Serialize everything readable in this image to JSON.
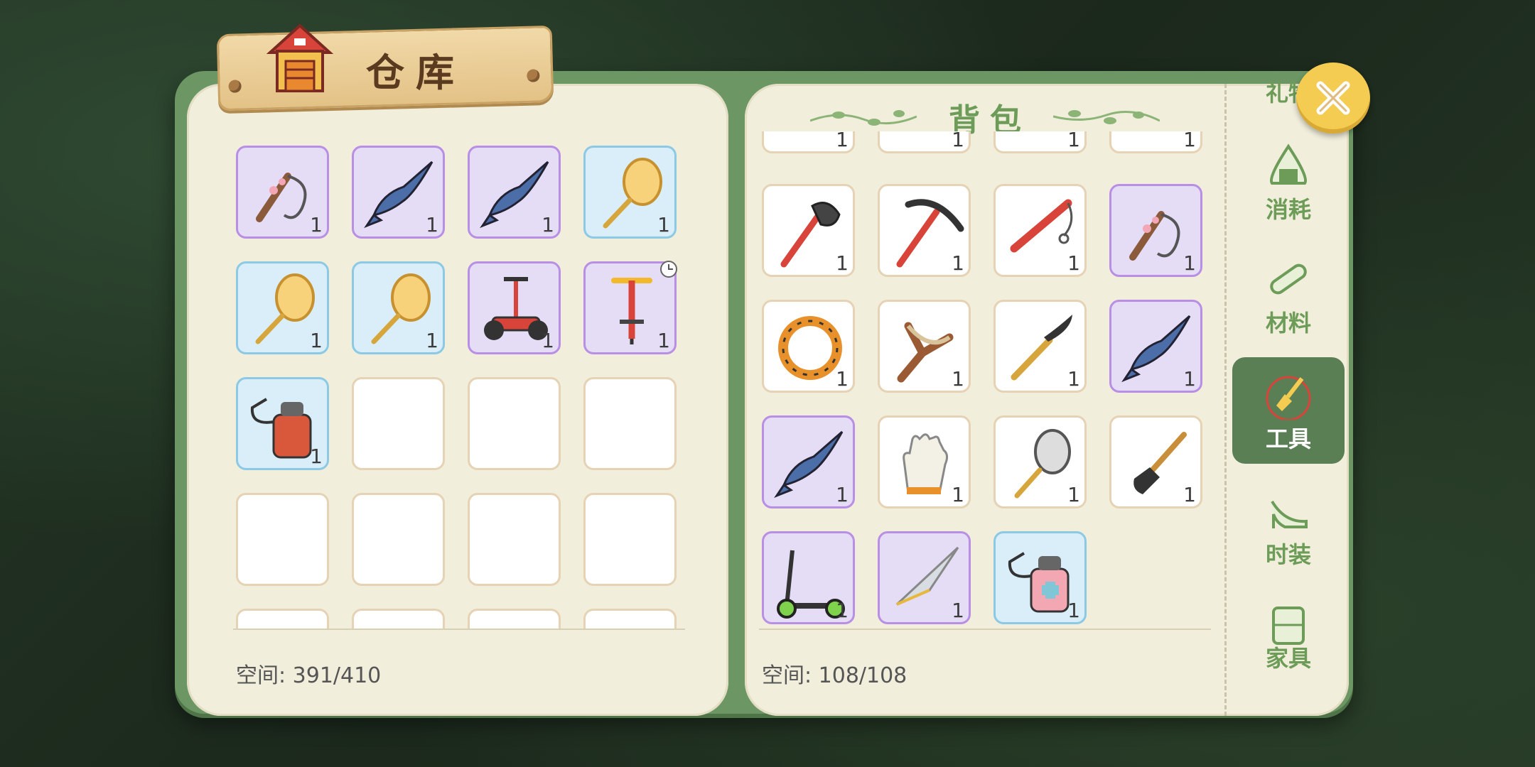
{
  "warehouse": {
    "title": "仓库",
    "space_label": "空间: 391/410",
    "items": [
      {
        "icon": "whip-icon",
        "qty": "1",
        "rarity": "purple"
      },
      {
        "icon": "swordfish-icon",
        "qty": "1",
        "rarity": "purple"
      },
      {
        "icon": "swordfish-icon",
        "qty": "1",
        "rarity": "purple"
      },
      {
        "icon": "butterfly-net-icon",
        "qty": "1",
        "rarity": "blue"
      },
      {
        "icon": "butterfly-net-icon",
        "qty": "1",
        "rarity": "blue"
      },
      {
        "icon": "butterfly-net-icon",
        "qty": "1",
        "rarity": "blue"
      },
      {
        "icon": "segway-icon",
        "qty": "1",
        "rarity": "purple"
      },
      {
        "icon": "pogo-stick-icon",
        "qty": "1",
        "rarity": "purple",
        "timed": true
      },
      {
        "icon": "sprayer-icon",
        "qty": "1",
        "rarity": "blue"
      }
    ]
  },
  "backpack": {
    "title": "背包",
    "space_label": "空间: 108/108",
    "items": [
      {
        "icon": "item-partial-icon",
        "qty": "1",
        "rarity": "none"
      },
      {
        "icon": "item-partial-icon",
        "qty": "1",
        "rarity": "none"
      },
      {
        "icon": "item-partial-icon",
        "qty": "1",
        "rarity": "none"
      },
      {
        "icon": "item-partial-icon",
        "qty": "1",
        "rarity": "none"
      },
      {
        "icon": "axe-icon",
        "qty": "1",
        "rarity": "none"
      },
      {
        "icon": "pickaxe-icon",
        "qty": "1",
        "rarity": "none"
      },
      {
        "icon": "fishing-rod-icon",
        "qty": "1",
        "rarity": "none"
      },
      {
        "icon": "whip-icon",
        "qty": "1",
        "rarity": "purple"
      },
      {
        "icon": "tiger-rope-icon",
        "qty": "1",
        "rarity": "none"
      },
      {
        "icon": "slingshot-icon",
        "qty": "1",
        "rarity": "none"
      },
      {
        "icon": "sickle-icon",
        "qty": "1",
        "rarity": "none"
      },
      {
        "icon": "swordfish-icon",
        "qty": "1",
        "rarity": "purple"
      },
      {
        "icon": "swordfish-icon",
        "qty": "1",
        "rarity": "purple"
      },
      {
        "icon": "glove-icon",
        "qty": "1",
        "rarity": "none"
      },
      {
        "icon": "bug-net-icon",
        "qty": "1",
        "rarity": "none"
      },
      {
        "icon": "shovel-icon",
        "qty": "1",
        "rarity": "none"
      },
      {
        "icon": "scooter-icon",
        "qty": "1",
        "rarity": "purple"
      },
      {
        "icon": "paper-plane-icon",
        "qty": "1",
        "rarity": "purple"
      },
      {
        "icon": "pink-sprayer-icon",
        "qty": "1",
        "rarity": "blue"
      }
    ]
  },
  "tabs": [
    {
      "label": "礼物",
      "icon": "gift-icon"
    },
    {
      "label": "消耗",
      "icon": "rice-ball-icon"
    },
    {
      "label": "材料",
      "icon": "log-icon"
    },
    {
      "label": "工具",
      "icon": "shovel-tool-icon",
      "active": true
    },
    {
      "label": "时装",
      "icon": "high-heel-icon"
    },
    {
      "label": "家具",
      "icon": "furniture-icon"
    }
  ],
  "colors": {
    "accent_green": "#6c9c58",
    "frame_green": "#6c9764",
    "purple_rarity": "#b98ee5",
    "blue_rarity": "#8cc9e5"
  }
}
